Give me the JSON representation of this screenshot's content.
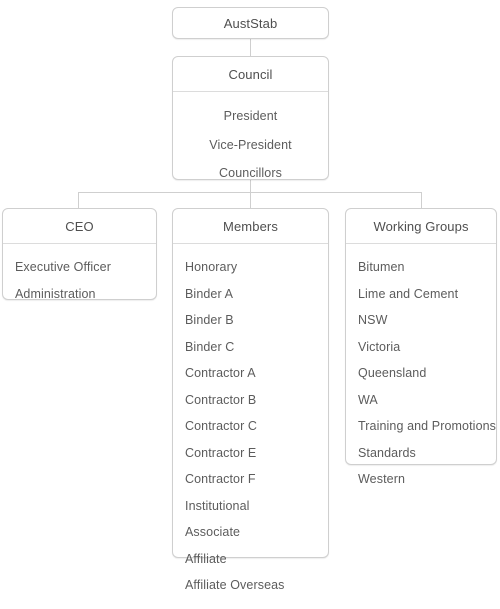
{
  "chart": {
    "type": "org-chart",
    "root": {
      "title": "AustStab"
    },
    "council": {
      "title": "Council",
      "items": [
        "President",
        "Vice-President",
        "Councillors"
      ]
    },
    "branches": [
      {
        "id": "ceo",
        "title": "CEO",
        "items": [
          "Executive Officer",
          "Administration"
        ]
      },
      {
        "id": "members",
        "title": "Members",
        "items": [
          "Honorary",
          "Binder A",
          "Binder B",
          "Binder C",
          "Contractor A",
          "Contractor B",
          "Contractor C",
          "Contractor E",
          "Contractor F",
          "Institutional",
          "Associate",
          "Affiliate",
          "Affiliate Overseas"
        ]
      },
      {
        "id": "working_groups",
        "title": "Working Groups",
        "items": [
          "Bitumen",
          "Lime and Cement",
          "NSW",
          "Victoria",
          "Queensland",
          "WA",
          "Training and Promotions",
          "Standards",
          "Western"
        ]
      }
    ],
    "colors": {
      "border": "#cfcfcf",
      "divider": "#dcdcdc",
      "text": "#5c5c5c",
      "title_text": "#4f4f4f",
      "background": "#ffffff"
    }
  }
}
